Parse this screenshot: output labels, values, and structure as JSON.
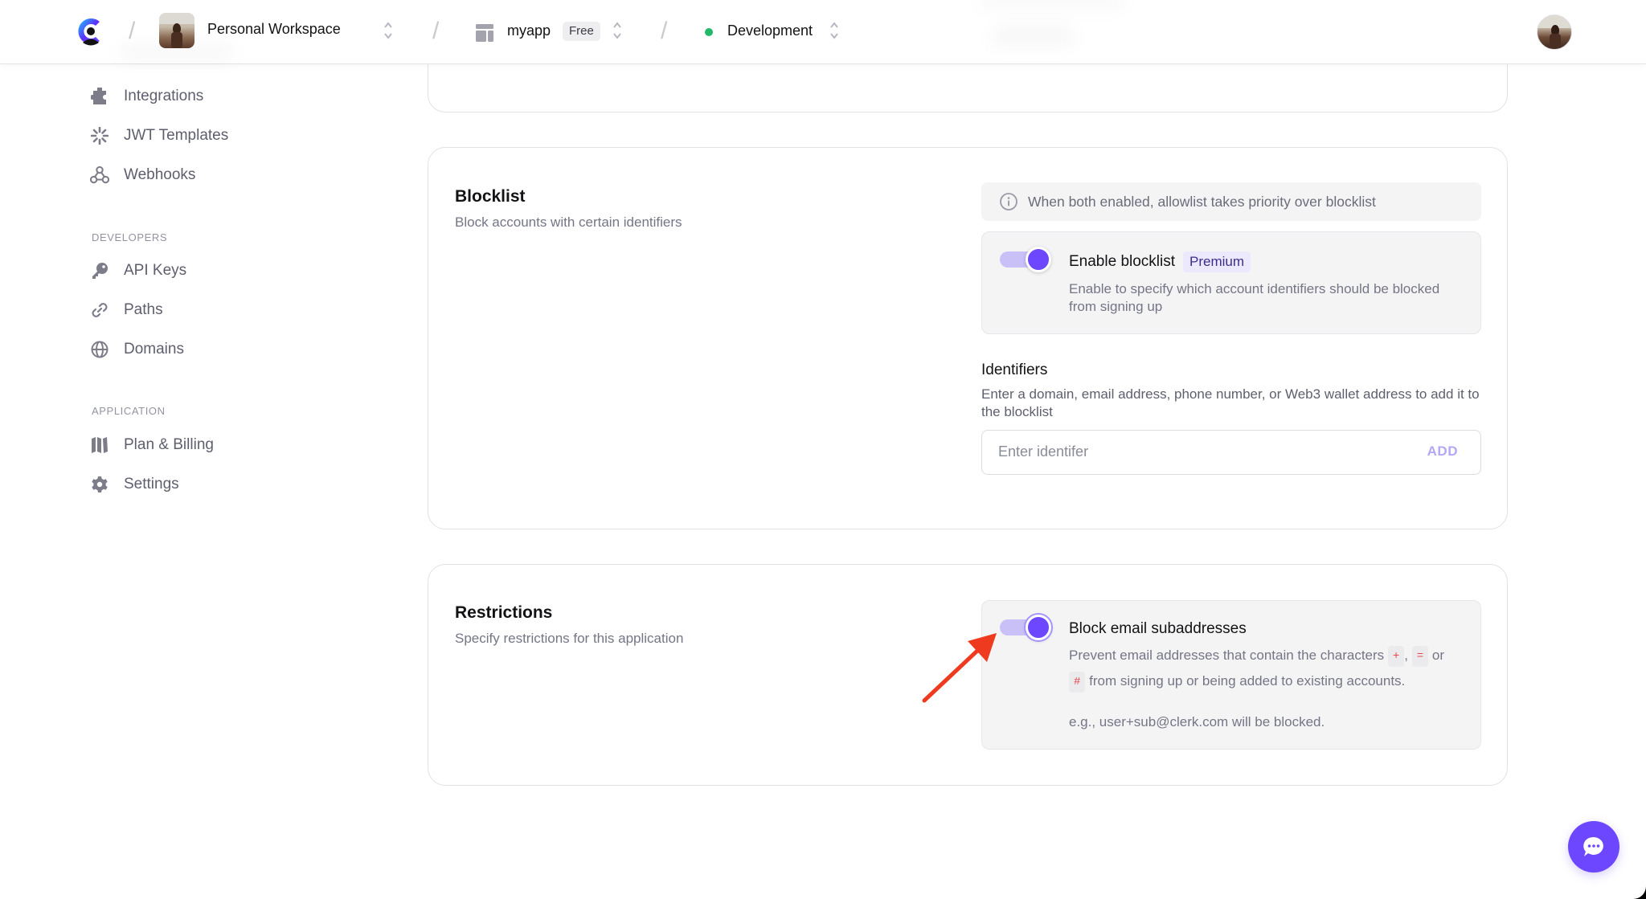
{
  "topbar": {
    "workspace_name": "Personal Workspace",
    "app_name": "myapp",
    "app_plan_badge": "Free",
    "environment_name": "Development",
    "environment_status_color": "#22b868",
    "separator": "/"
  },
  "sidebar": {
    "items_top": [
      {
        "label": "Integrations",
        "icon": "puzzle-icon"
      },
      {
        "label": "JWT Templates",
        "icon": "sparkle-icon"
      },
      {
        "label": "Webhooks",
        "icon": "webhook-icon"
      }
    ],
    "sections": [
      {
        "title": "DEVELOPERS",
        "items": [
          {
            "label": "API Keys",
            "icon": "key-icon"
          },
          {
            "label": "Paths",
            "icon": "link-icon"
          },
          {
            "label": "Domains",
            "icon": "globe-icon"
          }
        ]
      },
      {
        "title": "APPLICATION",
        "items": [
          {
            "label": "Plan & Billing",
            "icon": "map-icon"
          },
          {
            "label": "Settings",
            "icon": "gear-icon"
          }
        ]
      }
    ]
  },
  "blocklist": {
    "title": "Blocklist",
    "subtitle": "Block accounts with certain identifiers",
    "info": "When both enabled, allowlist takes priority over blocklist",
    "toggle": {
      "title": "Enable blocklist",
      "badge": "Premium",
      "description": "Enable to specify which account identifiers should be blocked from signing up",
      "enabled": true
    },
    "identifiers": {
      "label": "Identifiers",
      "description": "Enter a domain, email address, phone number, or Web3 wallet address to add it to the blocklist",
      "placeholder": "Enter identifer",
      "value": "",
      "add_label": "ADD"
    }
  },
  "restrictions": {
    "title": "Restrictions",
    "subtitle": "Specify restrictions for this application",
    "toggle": {
      "title": "Block email subaddresses",
      "enabled": true,
      "desc_part1": "Prevent email addresses that contain the characters",
      "char1": "+",
      "comma": ",",
      "char2": "=",
      "or": "or",
      "char3": "#",
      "desc_part2": "from signing up or being added to existing accounts.",
      "example": "e.g., user+sub@clerk.com will be blocked."
    }
  },
  "colors": {
    "accent": "#6c47ff",
    "toggle_track": "#c8c0f7",
    "annotation_arrow": "#ee3a1f",
    "code_text": "#e5484d"
  }
}
